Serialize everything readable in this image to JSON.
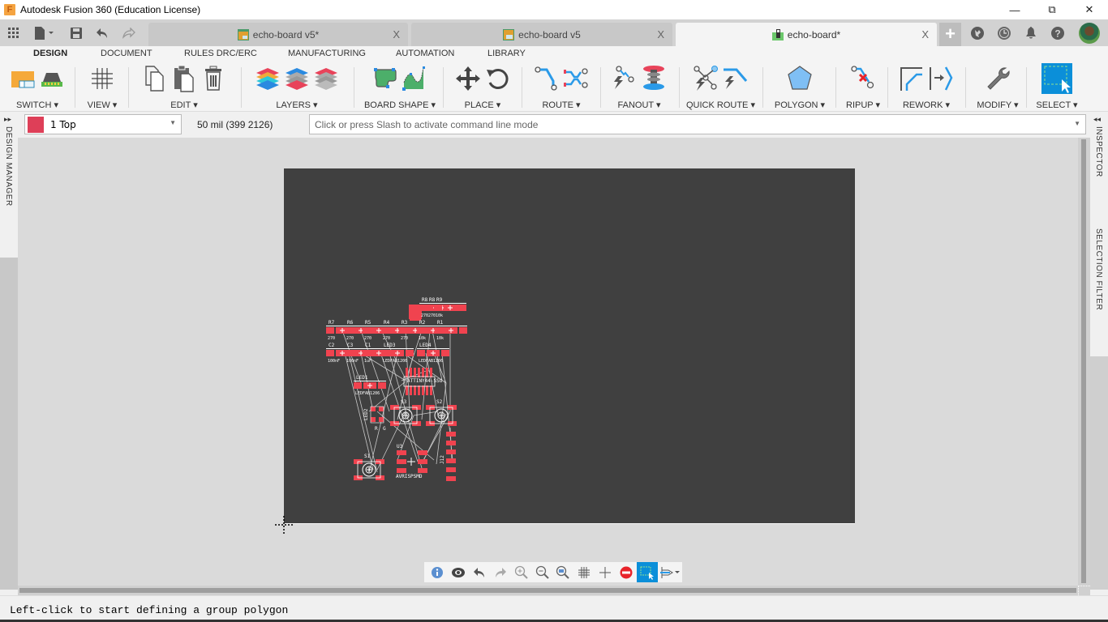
{
  "window": {
    "title": "Autodesk Fusion 360 (Education License)",
    "logo_letter": "F",
    "controls": {
      "minimize": "—",
      "restore": "⧉",
      "close": "✕"
    }
  },
  "quick_access": {
    "icons": [
      "app-grid-icon",
      "file-icon",
      "save-icon",
      "undo-icon",
      "redo-icon"
    ]
  },
  "document_tabs": [
    {
      "label": "echo-board v5*",
      "icon": "board-icon",
      "active": false,
      "close": "X"
    },
    {
      "label": "echo-board v5",
      "icon": "board-icon",
      "active": false,
      "close": "X"
    },
    {
      "label": "echo-board*",
      "icon": "pcb-icon",
      "active": true,
      "close": "X"
    }
  ],
  "header_icons": {
    "add": "+",
    "items": [
      "extensions-icon",
      "job-status-icon",
      "notifications-icon",
      "help-icon",
      "user-avatar"
    ],
    "help_glyph": "?"
  },
  "ribbon": {
    "tabs": [
      {
        "label": "DESIGN",
        "active": true
      },
      {
        "label": "DOCUMENT",
        "active": false
      },
      {
        "label": "RULES DRC/ERC",
        "active": false
      },
      {
        "label": "MANUFACTURING",
        "active": false
      },
      {
        "label": "AUTOMATION",
        "active": false
      },
      {
        "label": "LIBRARY",
        "active": false
      }
    ],
    "groups": [
      {
        "label": "SWITCH ▾"
      },
      {
        "label": "VIEW ▾"
      },
      {
        "label": "EDIT ▾"
      },
      {
        "label": "LAYERS ▾"
      },
      {
        "label": "BOARD SHAPE ▾"
      },
      {
        "label": "PLACE ▾"
      },
      {
        "label": "ROUTE ▾"
      },
      {
        "label": "FANOUT ▾"
      },
      {
        "label": "QUICK ROUTE ▾"
      },
      {
        "label": "POLYGON ▾"
      },
      {
        "label": "RIPUP ▾"
      },
      {
        "label": "REWORK ▾"
      },
      {
        "label": "MODIFY ▾"
      },
      {
        "label": "SELECT ▾"
      }
    ]
  },
  "command_bar": {
    "layer": {
      "name": "1 Top",
      "color": "#de3f58"
    },
    "coordinates": "50 mil (399 2126)",
    "command_placeholder": "Click or press Slash to activate command line mode"
  },
  "side_panels": {
    "left": "DESIGN MANAGER",
    "left_toggle": "▸▸",
    "right_top": "INSPECTOR",
    "right_bottom": "SELECTION FILTER",
    "right_toggle": "◂◂"
  },
  "board": {
    "colors": {
      "background": "#404040",
      "pad": "#f0434f",
      "silk": "#ffffff",
      "airwire": "#c8c8c8"
    },
    "labels": {
      "top_row": [
        "R8",
        "R9"
      ],
      "mid_row": [
        "R7",
        "R6",
        "R5",
        "R4",
        "R3",
        "R2",
        "R1"
      ],
      "mid_values": [
        "270",
        "270",
        "270",
        "270",
        "270",
        "10k",
        "10k"
      ],
      "top_values": [
        "270",
        "10k"
      ],
      "cap_row": [
        "C2",
        "C3",
        "C1",
        "LED3",
        "LED4"
      ],
      "cap_values": [
        "100nF",
        "100nF",
        "1uF",
        "LEDFAB1206",
        "LEDFAB1206"
      ],
      "led": "LED1",
      "led_value": "LEDFAB1206",
      "mcu": "ATTINY44-SSU",
      "switches": [
        "S3",
        "S2",
        "S1"
      ],
      "rgb": "LED2",
      "rgb_pins": [
        "R",
        "G"
      ],
      "isp": "U3",
      "isp_value": "AVRISPSMD",
      "ftdi": "J12"
    }
  },
  "canvas_toolbar": {
    "tools": [
      "info-icon",
      "visibility-icon",
      "undo-icon",
      "redo-icon",
      "zoom-in-icon",
      "zoom-out-icon",
      "zoom-fit-icon",
      "grid-icon",
      "crosshair-icon",
      "stop-icon",
      "select-icon",
      "routing-icon"
    ]
  },
  "status": {
    "message": "Left-click to start defining a group polygon"
  }
}
